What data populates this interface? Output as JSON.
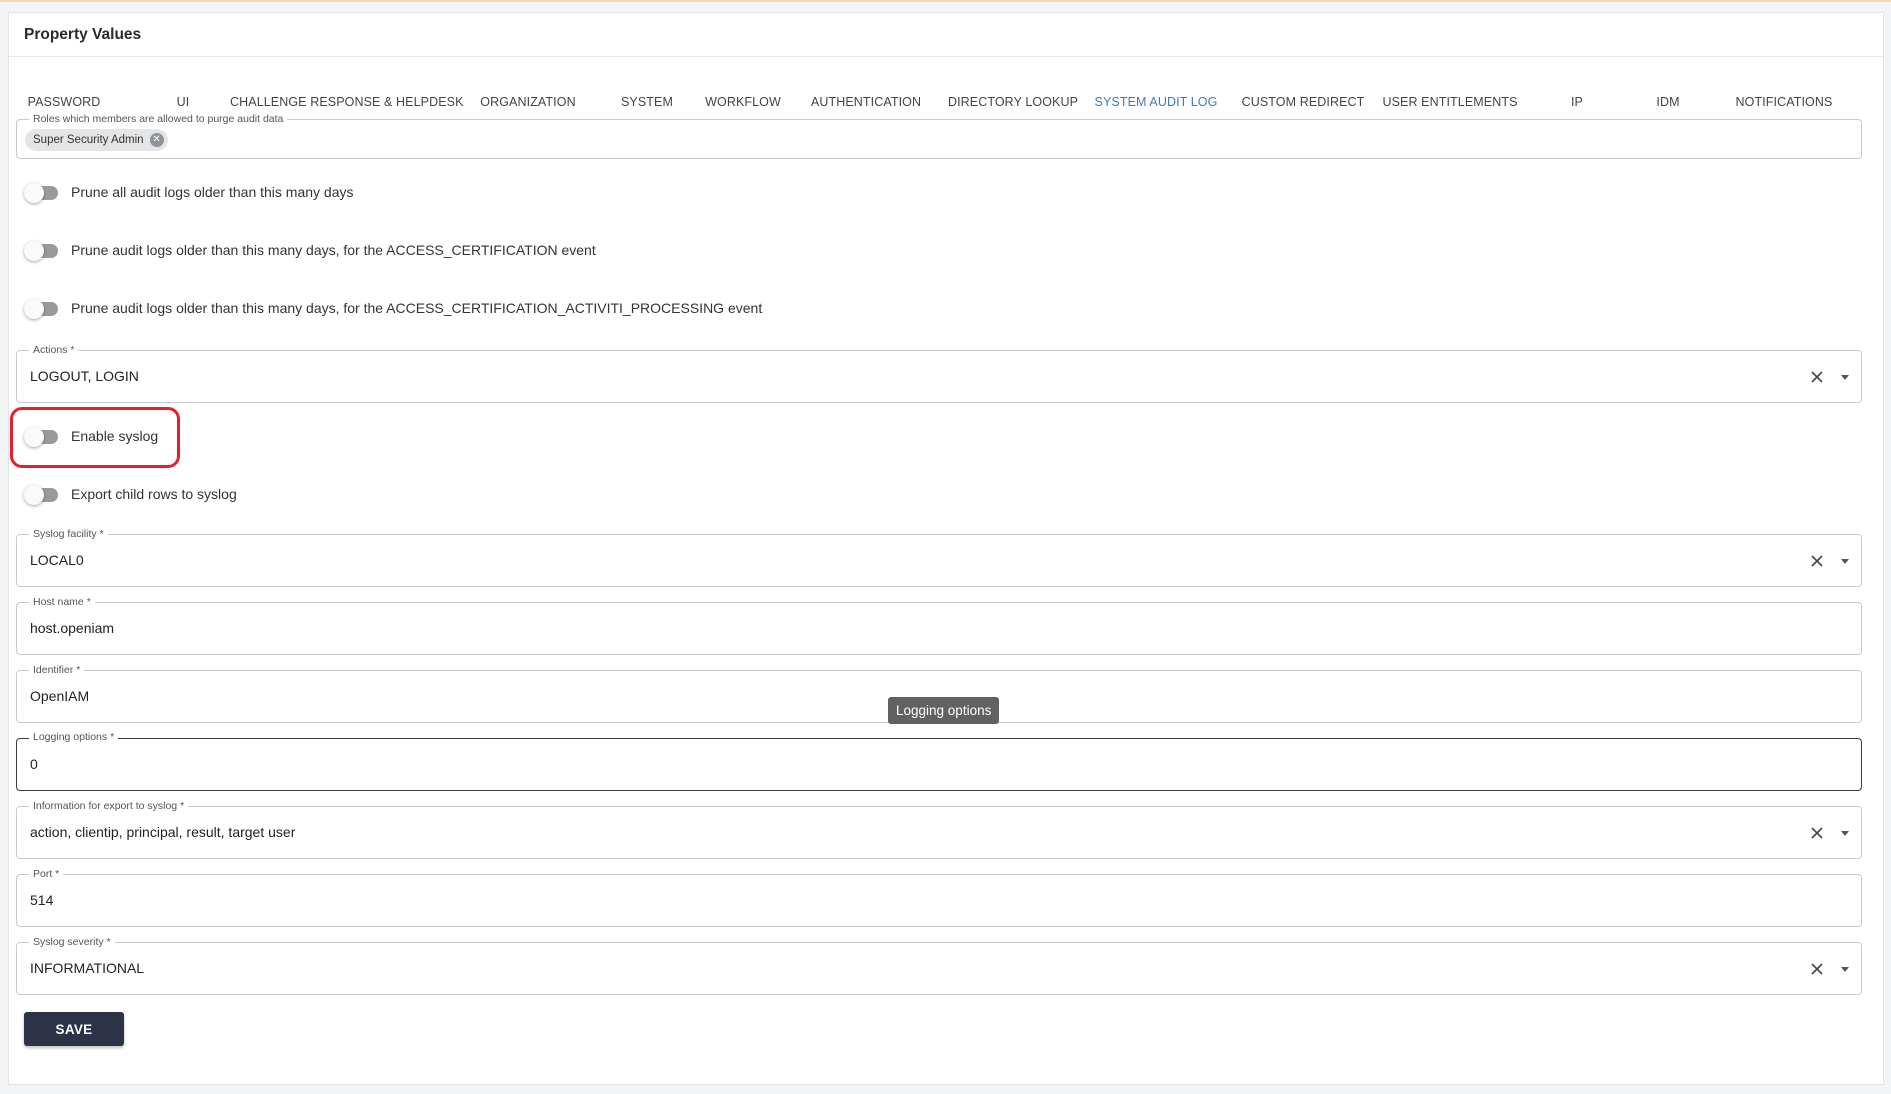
{
  "page": {
    "title": "Property Values"
  },
  "tabs": [
    {
      "label": "PASSWORD"
    },
    {
      "label": "UI"
    },
    {
      "label": "CHALLENGE RESPONSE & HELPDESK"
    },
    {
      "label": "ORGANIZATION"
    },
    {
      "label": "SYSTEM"
    },
    {
      "label": "WORKFLOW"
    },
    {
      "label": "AUTHENTICATION"
    },
    {
      "label": "DIRECTORY LOOKUP"
    },
    {
      "label": "SYSTEM AUDIT LOG",
      "active": true
    },
    {
      "label": "CUSTOM REDIRECT"
    },
    {
      "label": "USER ENTITLEMENTS"
    },
    {
      "label": "IP"
    },
    {
      "label": "IDM"
    },
    {
      "label": "NOTIFICATIONS"
    }
  ],
  "form": {
    "purge_roles": {
      "label": "Roles which members are allowed to purge audit data",
      "chips": [
        "Super Security Admin"
      ]
    },
    "toggles": {
      "prune_all": {
        "label": "Prune all audit logs older than this many days",
        "on": false
      },
      "prune_access_cert": {
        "label": "Prune audit logs older than this many days, for the ACCESS_CERTIFICATION event",
        "on": false
      },
      "prune_access_cert_activiti": {
        "label": "Prune audit logs older than this many days, for the ACCESS_CERTIFICATION_ACTIVITI_PROCESSING event",
        "on": false
      },
      "enable_syslog": {
        "label": "Enable syslog",
        "on": false
      },
      "export_child_rows": {
        "label": "Export child rows to syslog",
        "on": false
      }
    },
    "actions": {
      "label": "Actions *",
      "value": "LOGOUT, LOGIN"
    },
    "syslog_facility": {
      "label": "Syslog facility *",
      "value": "LOCAL0"
    },
    "host_name": {
      "label": "Host name *",
      "value": "host.openiam"
    },
    "identifier": {
      "label": "Identifier *",
      "value": "OpenIAM"
    },
    "logging_options": {
      "label": "Logging options *",
      "value": "0",
      "tooltip": "Logging options"
    },
    "export_info": {
      "label": "Information for export to syslog *",
      "value": "action, clientip, principal, result, target user"
    },
    "port": {
      "label": "Port *",
      "value": "514"
    },
    "syslog_severity": {
      "label": "Syslog severity *",
      "value": "INFORMATIONAL"
    },
    "save_label": "SAVE"
  },
  "colors": {
    "active_tab_text": "#3f7cb5",
    "active_tab_underline": "#e7a45c",
    "highlight_border": "#e3202b",
    "save_button_bg": "#2e3246"
  }
}
